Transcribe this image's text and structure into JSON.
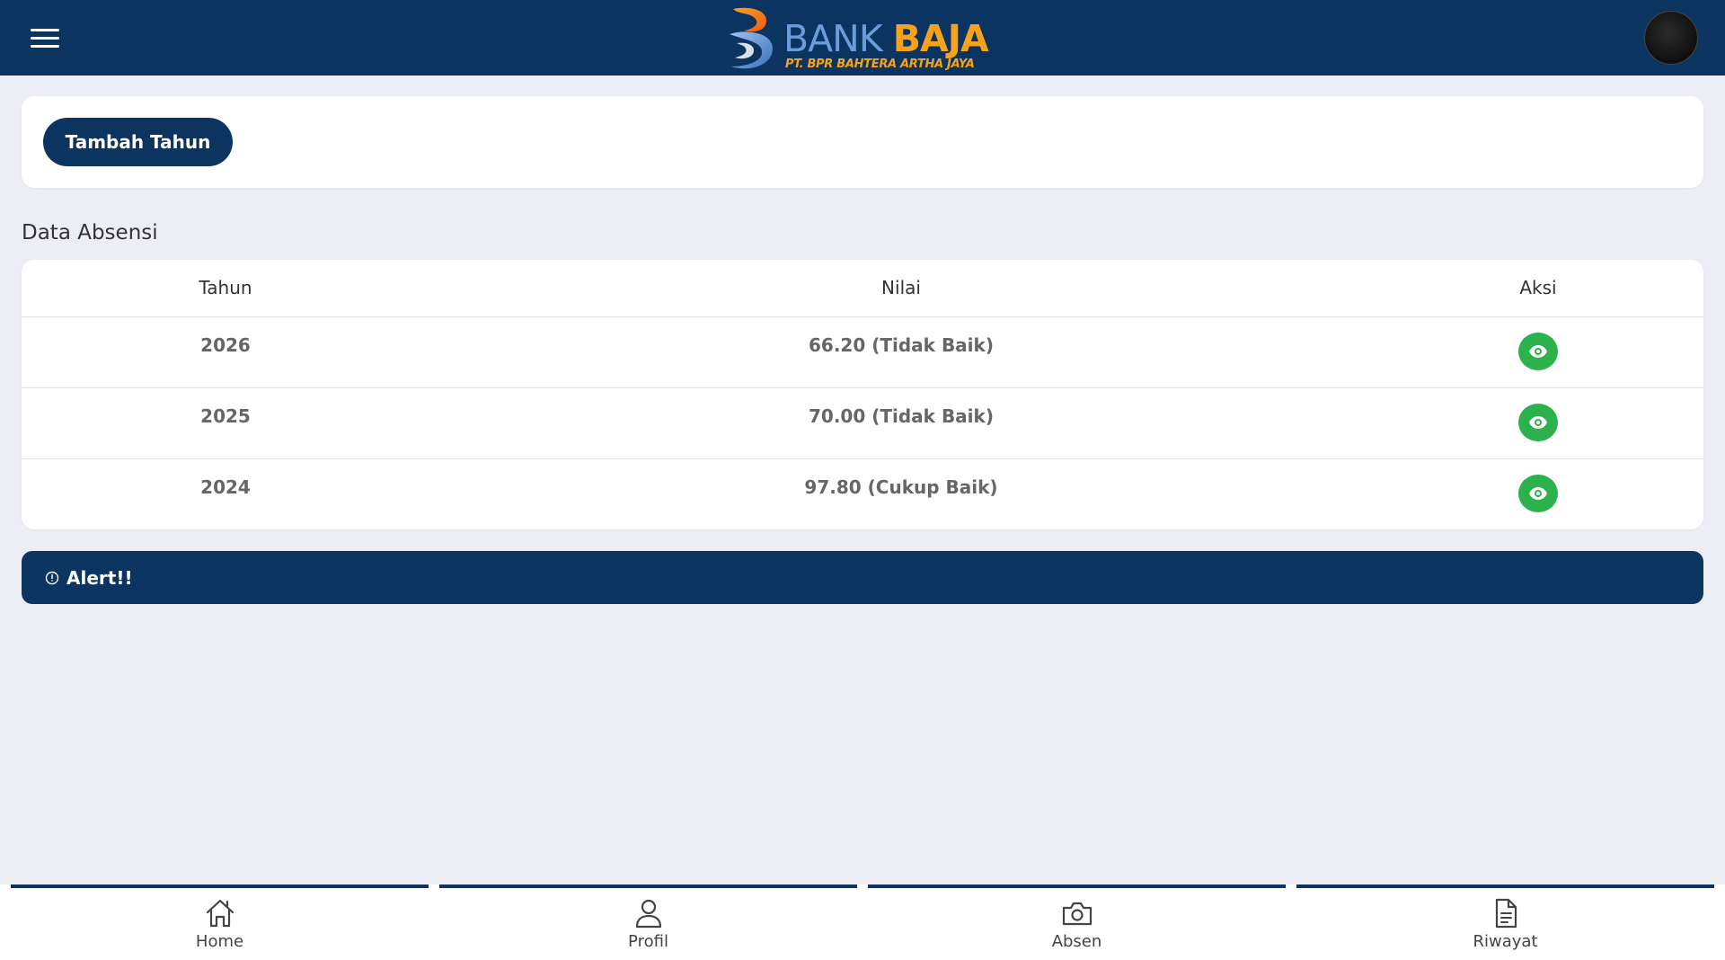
{
  "header": {
    "brand_bank": "BANK",
    "brand_baja": "BAJA",
    "brand_subtitle": "PT. BPR BAHTERA ARTHA JAYA",
    "menu_icon": "hamburger-icon",
    "avatar_icon": "user-avatar"
  },
  "toolbar": {
    "add_year_label": "Tambah Tahun"
  },
  "section": {
    "title": "Data Absensi"
  },
  "table": {
    "headers": {
      "tahun": "Tahun",
      "nilai": "Nilai",
      "aksi": "Aksi"
    },
    "rows": [
      {
        "tahun": "2026",
        "nilai": "66.20 (Tidak Baik)",
        "aksi_icon": "eye-icon"
      },
      {
        "tahun": "2025",
        "nilai": "70.00 (Tidak Baik)",
        "aksi_icon": "eye-icon"
      },
      {
        "tahun": "2024",
        "nilai": "97.80 (Cukup Baik)",
        "aksi_icon": "eye-icon"
      }
    ]
  },
  "alert": {
    "icon": "info-circle-icon",
    "text": "Alert!!"
  },
  "bottom_nav": [
    {
      "label": "Home",
      "icon": "home-icon"
    },
    {
      "label": "Profil",
      "icon": "user-icon"
    },
    {
      "label": "Absen",
      "icon": "camera-icon"
    },
    {
      "label": "Riwayat",
      "icon": "document-icon"
    }
  ],
  "colors": {
    "primary": "#0b3460",
    "accent_green": "#2bb24c",
    "background": "#ecedf5",
    "brand_orange": "#f7a21b",
    "brand_blue": "#6b9ddc"
  }
}
